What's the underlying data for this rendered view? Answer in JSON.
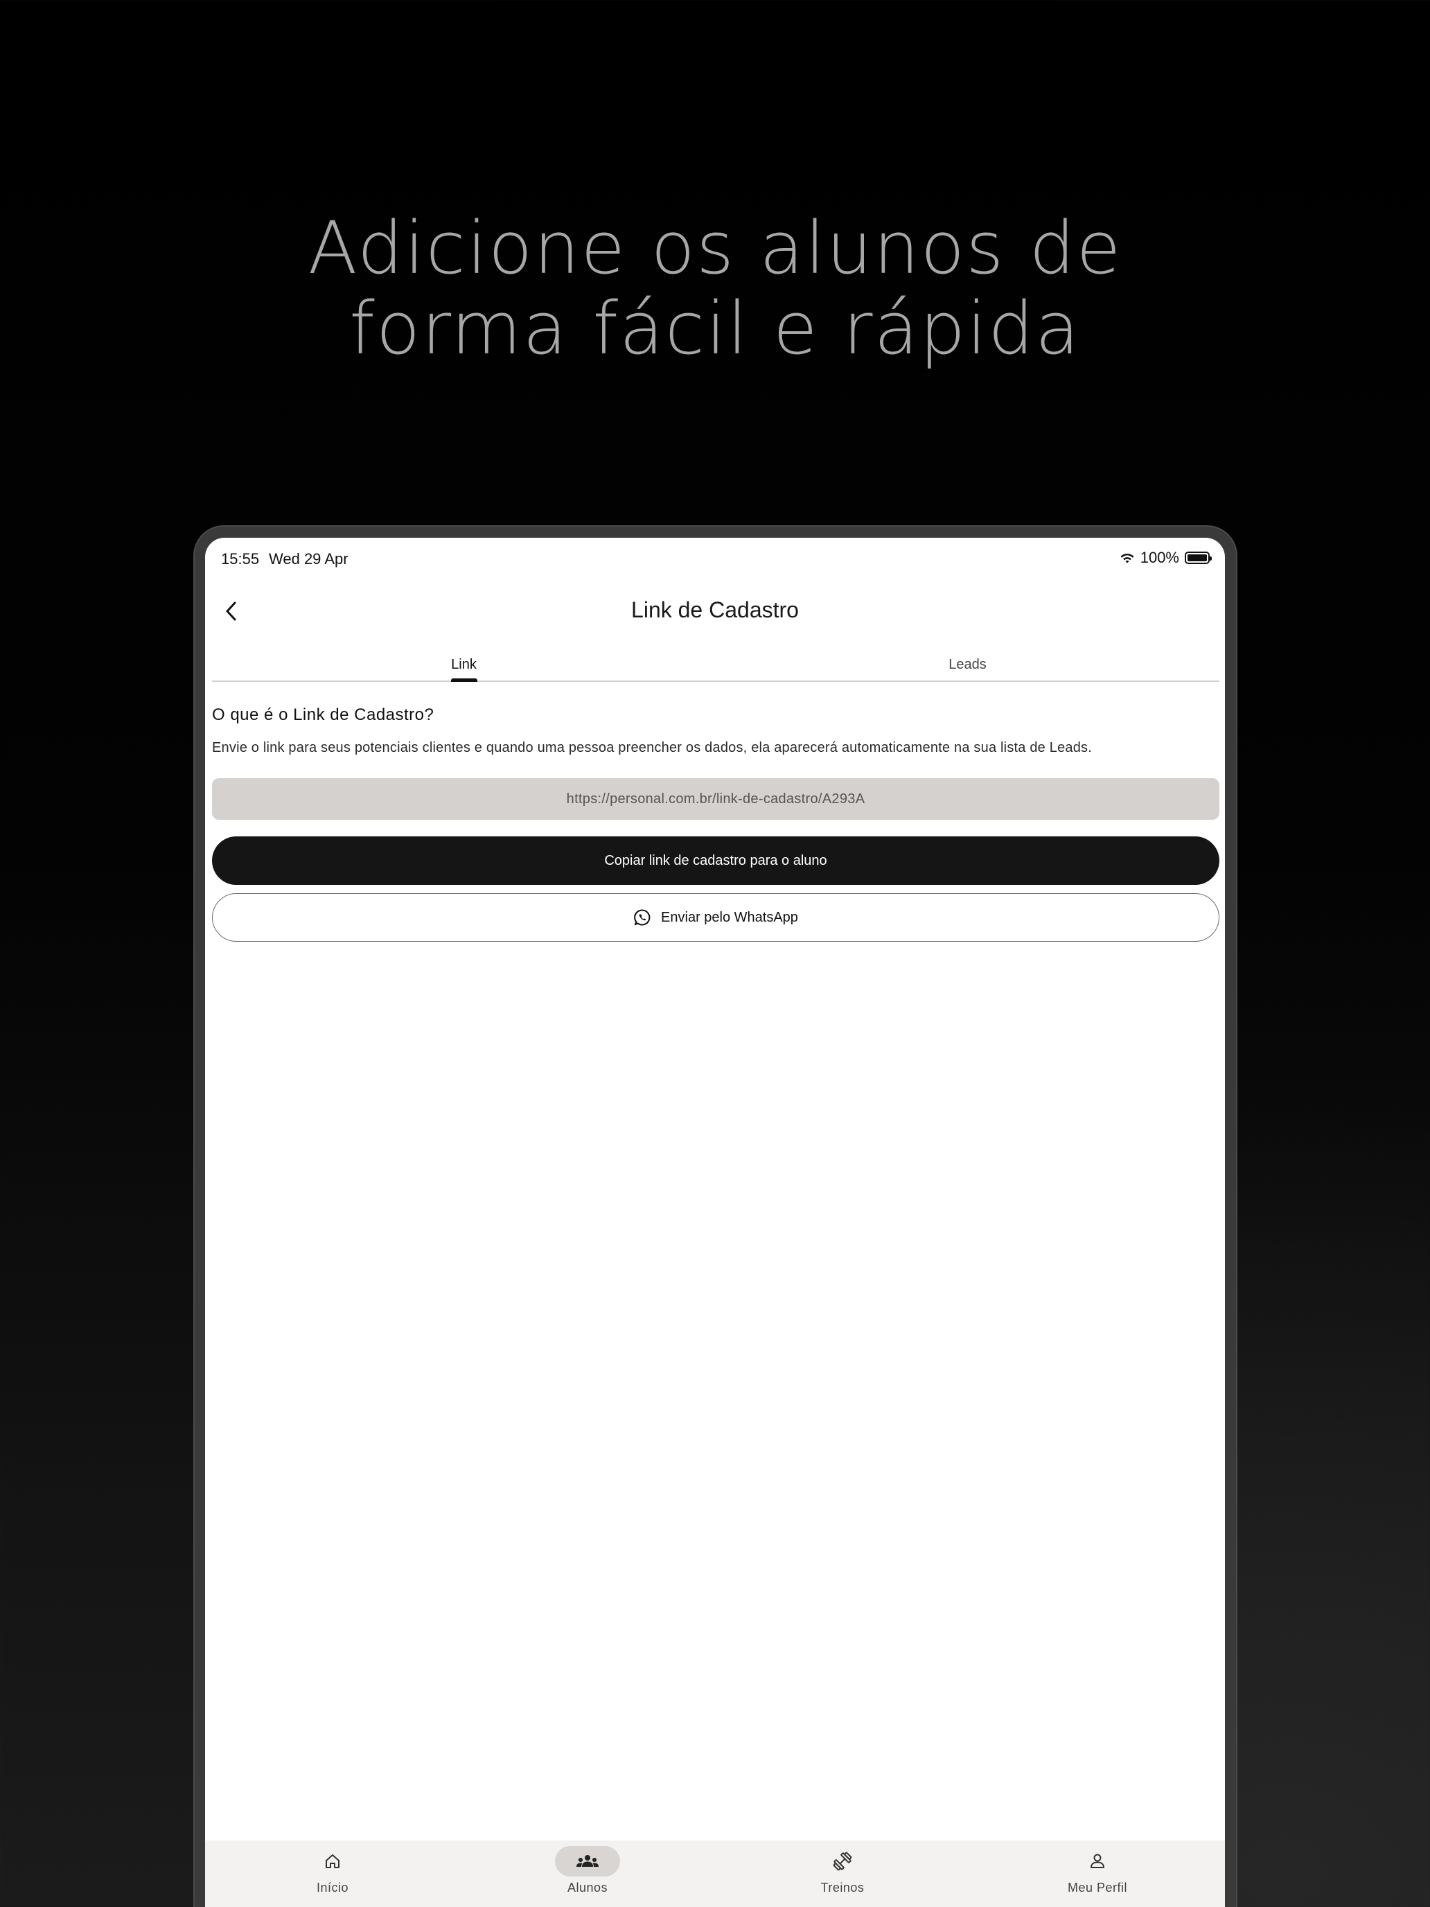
{
  "headline": {
    "line1": "Adicione os alunos de",
    "line2": "forma fácil e rápida"
  },
  "status_bar": {
    "time": "15:55",
    "date": "Wed 29 Apr",
    "battery": "100%"
  },
  "app_bar": {
    "title": "Link de Cadastro",
    "back_icon": "chevron-left-icon"
  },
  "tabs": [
    {
      "label": "Link",
      "active": true
    },
    {
      "label": "Leads",
      "active": false
    }
  ],
  "section": {
    "title": "O que é o Link de Cadastro?",
    "description": "Envie o link para seus potenciais clientes e quando uma pessoa preencher os dados, ela aparecerá automaticamente na sua lista de Leads."
  },
  "link_field": {
    "value": "https://personal.com.br/link-de-cadastro/A293A"
  },
  "buttons": {
    "copy_label": "Copiar link de cadastro para o aluno",
    "whatsapp_label": "Enviar pelo WhatsApp",
    "whatsapp_icon": "whatsapp-icon"
  },
  "bottom_nav": [
    {
      "label": "Início",
      "icon": "home-icon",
      "active": false
    },
    {
      "label": "Alunos",
      "icon": "group-icon",
      "active": true
    },
    {
      "label": "Treinos",
      "icon": "dumbbell-icon",
      "active": false
    },
    {
      "label": "Meu Perfil",
      "icon": "person-icon",
      "active": false
    }
  ],
  "colors": {
    "primary_button": "#151515",
    "link_field_bg": "#d4d1cf",
    "bottom_nav_bg": "#f4f2f1",
    "headline_text": "#a7a7a7"
  }
}
